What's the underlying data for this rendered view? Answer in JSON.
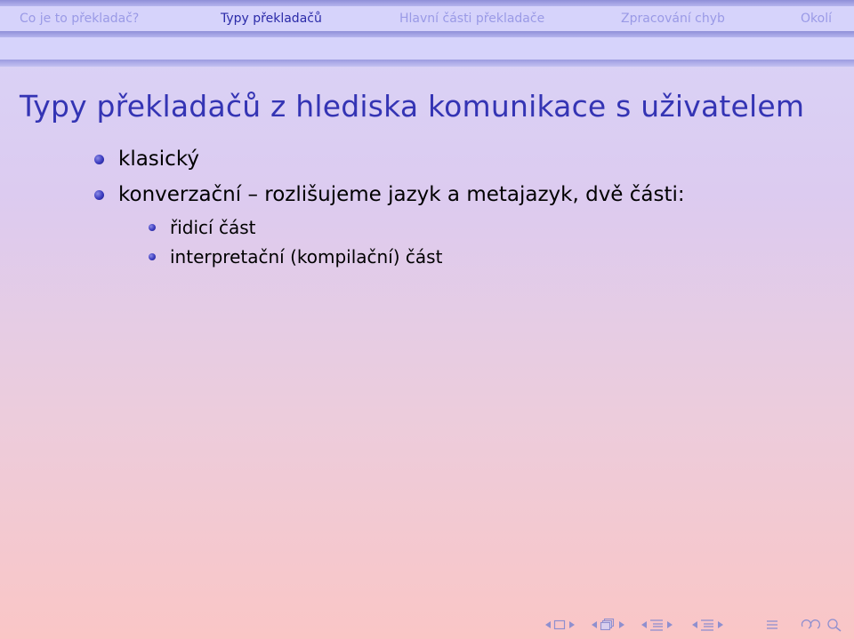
{
  "nav": {
    "sections": [
      {
        "label": "Co je to překladač?"
      },
      {
        "label": "Typy překladačů"
      },
      {
        "label": "Hlavní části překladače"
      },
      {
        "label": "Zpracování chyb"
      },
      {
        "label": "Okolí"
      }
    ],
    "active_index": 1
  },
  "frame": {
    "title": "Typy překladačů z hlediska komunikace s uživatelem",
    "items": [
      {
        "text": "klasický"
      },
      {
        "text": "konverzační – rozlišujeme jazyk a metajazyk, dvě části:"
      }
    ],
    "subitems": [
      {
        "text": "řidicí část"
      },
      {
        "text": "interpretační (kompilační) část"
      }
    ]
  },
  "colors": {
    "title": "#3434b4",
    "nav_active": "#2a2aa8",
    "nav_inactive": "#9a9ae6",
    "bullet": "#3a3abf"
  },
  "bottom_nav": {
    "icons": [
      "prev-slide-icon",
      "slide-icon",
      "next-slide-icon",
      "prev-frame-icon",
      "frame-icon",
      "next-frame-icon",
      "prev-subsection-icon",
      "subsection-icon",
      "next-subsection-icon",
      "prev-section-icon",
      "section-icon",
      "next-section-icon",
      "toc-icon",
      "back-icon",
      "search-icon"
    ]
  }
}
